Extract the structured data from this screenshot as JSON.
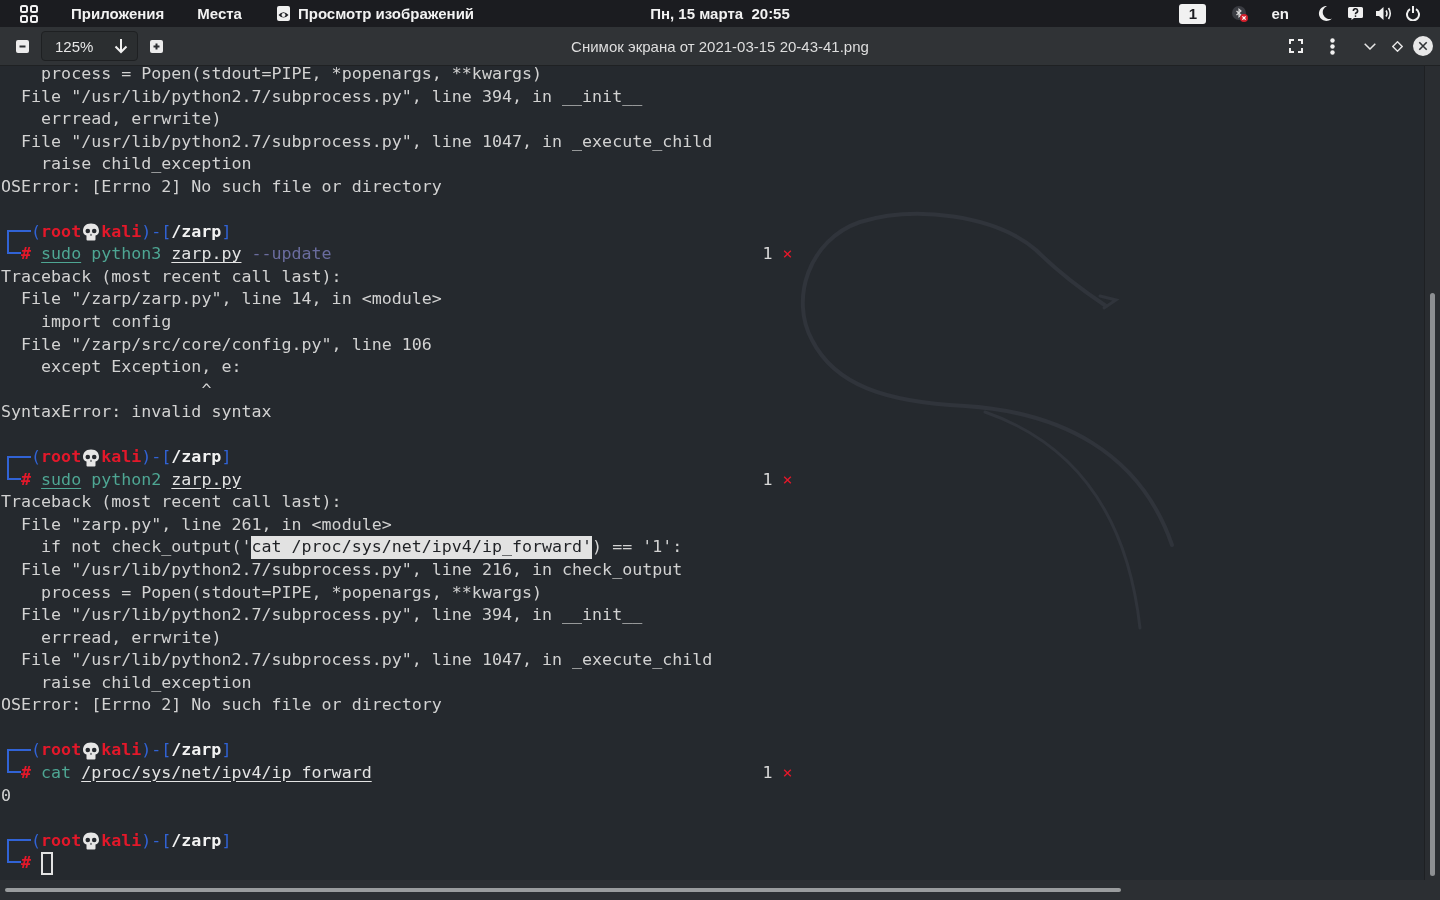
{
  "top_bar": {
    "menus": [
      "Приложения",
      "Места"
    ],
    "app_menu": "Просмотр изображений",
    "clock": "Пн, 15 марта  20:55",
    "workspace": "1",
    "keyboard_layout": "en"
  },
  "header_bar": {
    "zoom": "125%",
    "title": "Снимок экрана от 2021-03-15 20-43-41.png"
  },
  "terminal": {
    "lines": [
      {
        "kind": "output",
        "text": "    process = Popen(stdout=PIPE, *popenargs, **kwargs)"
      },
      {
        "kind": "output",
        "text": "  File \"/usr/lib/python2.7/subprocess.py\", line 394, in __init__"
      },
      {
        "kind": "output",
        "text": "    errread, errwrite)"
      },
      {
        "kind": "output",
        "text": "  File \"/usr/lib/python2.7/subprocess.py\", line 1047, in _execute_child"
      },
      {
        "kind": "output",
        "text": "    raise child_exception"
      },
      {
        "kind": "output",
        "text": "OSError: [Errno 2] No such file or directory"
      },
      {
        "kind": "blank"
      },
      {
        "kind": "prompt",
        "open": "(",
        "user": "root",
        "host": "kali",
        "middle": ")-[",
        "cwd": "/zarp",
        "close": "]"
      },
      {
        "kind": "command",
        "sign": "#",
        "words": [
          {
            "text": "sudo",
            "kind": "precommand"
          },
          {
            "text": "python3",
            "kind": "command"
          },
          {
            "text": "zarp.py",
            "kind": "path"
          },
          {
            "text": "--update",
            "kind": "option"
          }
        ],
        "exit_code": "1",
        "exit_mark": "×"
      },
      {
        "kind": "output",
        "text": "Traceback (most recent call last):"
      },
      {
        "kind": "output",
        "text": "  File \"/zarp/zarp.py\", line 14, in <module>"
      },
      {
        "kind": "output",
        "text": "    import config"
      },
      {
        "kind": "output",
        "text": "  File \"/zarp/src/core/config.py\", line 106"
      },
      {
        "kind": "output",
        "text": "    except Exception, e:"
      },
      {
        "kind": "output",
        "text": "                    ^"
      },
      {
        "kind": "output",
        "text": "SyntaxError: invalid syntax"
      },
      {
        "kind": "blank"
      },
      {
        "kind": "prompt",
        "open": "(",
        "user": "root",
        "host": "kali",
        "middle": ")-[",
        "cwd": "/zarp",
        "close": "]"
      },
      {
        "kind": "command",
        "sign": "#",
        "words": [
          {
            "text": "sudo",
            "kind": "precommand"
          },
          {
            "text": "python2",
            "kind": "command"
          },
          {
            "text": "zarp.py",
            "kind": "path"
          }
        ],
        "exit_code": "1",
        "exit_mark": "×"
      },
      {
        "kind": "output",
        "text": "Traceback (most recent call last):"
      },
      {
        "kind": "output",
        "text": "  File \"zarp.py\", line 261, in <module>"
      },
      {
        "kind": "output",
        "segments": [
          {
            "text": "    if not check_output('",
            "selected": false
          },
          {
            "text": "cat /proc/sys/net/ipv4/ip_forward'",
            "selected": true
          },
          {
            "text": ") == '1':",
            "selected": false
          }
        ]
      },
      {
        "kind": "output",
        "text": "  File \"/usr/lib/python2.7/subprocess.py\", line 216, in check_output"
      },
      {
        "kind": "output",
        "text": "    process = Popen(stdout=PIPE, *popenargs, **kwargs)"
      },
      {
        "kind": "output",
        "text": "  File \"/usr/lib/python2.7/subprocess.py\", line 394, in __init__"
      },
      {
        "kind": "output",
        "text": "    errread, errwrite)"
      },
      {
        "kind": "output",
        "text": "  File \"/usr/lib/python2.7/subprocess.py\", line 1047, in _execute_child"
      },
      {
        "kind": "output",
        "text": "    raise child_exception"
      },
      {
        "kind": "output",
        "text": "OSError: [Errno 2] No such file or directory"
      },
      {
        "kind": "blank"
      },
      {
        "kind": "prompt",
        "open": "(",
        "user": "root",
        "host": "kali",
        "middle": ")-[",
        "cwd": "/zarp",
        "close": "]"
      },
      {
        "kind": "command",
        "sign": "#",
        "words": [
          {
            "text": "cat",
            "kind": "command"
          },
          {
            "text": "/proc/sys/net/ipv4/ip_forward",
            "kind": "path"
          }
        ],
        "exit_code": "1",
        "exit_mark": "×"
      },
      {
        "kind": "output",
        "text": "0"
      },
      {
        "kind": "blank"
      },
      {
        "kind": "prompt",
        "open": "(",
        "user": "root",
        "host": "kali",
        "middle": ")-[",
        "cwd": "/zarp",
        "close": "]"
      },
      {
        "kind": "command",
        "sign": "#",
        "cursor": true
      }
    ]
  }
}
